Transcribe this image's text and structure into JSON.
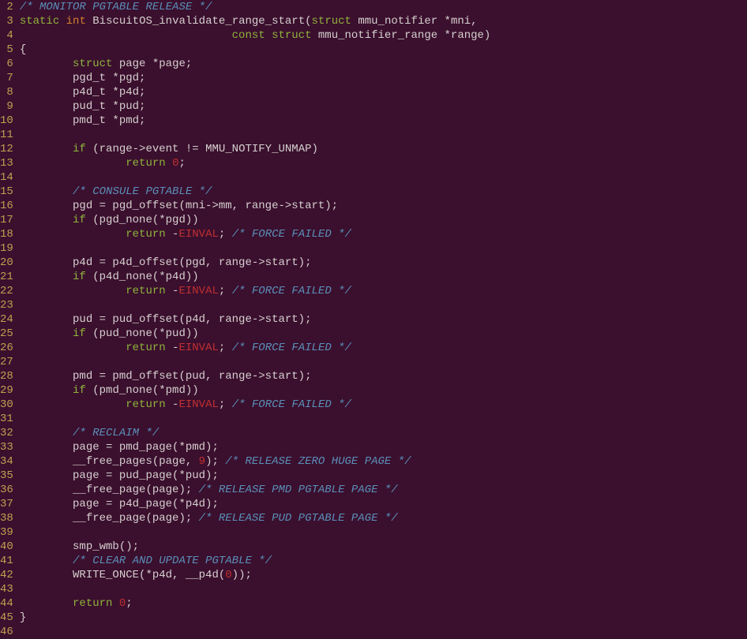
{
  "lines": [
    {
      "n": 2,
      "tokens": [
        {
          "cls": "c-comment",
          "t": "/* MONITOR PGTABLE RELEASE */"
        }
      ]
    },
    {
      "n": 3,
      "tokens": [
        {
          "cls": "c-keyword",
          "t": "static"
        },
        {
          "cls": "c-text",
          "t": " "
        },
        {
          "cls": "c-type",
          "t": "int"
        },
        {
          "cls": "c-text",
          "t": " BiscuitOS_invalidate_range_start("
        },
        {
          "cls": "c-keyword",
          "t": "struct"
        },
        {
          "cls": "c-text",
          "t": " mmu_notifier *mni,"
        }
      ]
    },
    {
      "n": 4,
      "tokens": [
        {
          "cls": "c-text",
          "t": "                                "
        },
        {
          "cls": "c-keyword",
          "t": "const"
        },
        {
          "cls": "c-text",
          "t": " "
        },
        {
          "cls": "c-keyword",
          "t": "struct"
        },
        {
          "cls": "c-text",
          "t": " mmu_notifier_range *range)"
        }
      ]
    },
    {
      "n": 5,
      "tokens": [
        {
          "cls": "c-text",
          "t": "{"
        }
      ]
    },
    {
      "n": 6,
      "tokens": [
        {
          "cls": "c-text",
          "t": "        "
        },
        {
          "cls": "c-keyword",
          "t": "struct"
        },
        {
          "cls": "c-text",
          "t": " page *page;"
        }
      ]
    },
    {
      "n": 7,
      "tokens": [
        {
          "cls": "c-text",
          "t": "        pgd_t *pgd;"
        }
      ]
    },
    {
      "n": 8,
      "tokens": [
        {
          "cls": "c-text",
          "t": "        p4d_t *p4d;"
        }
      ]
    },
    {
      "n": 9,
      "tokens": [
        {
          "cls": "c-text",
          "t": "        pud_t *pud;"
        }
      ]
    },
    {
      "n": 10,
      "tokens": [
        {
          "cls": "c-text",
          "t": "        pmd_t *pmd;"
        }
      ]
    },
    {
      "n": 11,
      "tokens": []
    },
    {
      "n": 12,
      "tokens": [
        {
          "cls": "c-text",
          "t": "        "
        },
        {
          "cls": "c-keyword",
          "t": "if"
        },
        {
          "cls": "c-text",
          "t": " (range->event != MMU_NOTIFY_UNMAP)"
        }
      ]
    },
    {
      "n": 13,
      "tokens": [
        {
          "cls": "c-text",
          "t": "                "
        },
        {
          "cls": "c-keyword",
          "t": "return"
        },
        {
          "cls": "c-text",
          "t": " "
        },
        {
          "cls": "c-num",
          "t": "0"
        },
        {
          "cls": "c-text",
          "t": ";"
        }
      ]
    },
    {
      "n": 14,
      "tokens": []
    },
    {
      "n": 15,
      "tokens": [
        {
          "cls": "c-text",
          "t": "        "
        },
        {
          "cls": "c-comment",
          "t": "/* CONSULE PGTABLE */"
        }
      ]
    },
    {
      "n": 16,
      "tokens": [
        {
          "cls": "c-text",
          "t": "        pgd = pgd_offset(mni->mm, range->start);"
        }
      ]
    },
    {
      "n": 17,
      "tokens": [
        {
          "cls": "c-text",
          "t": "        "
        },
        {
          "cls": "c-keyword",
          "t": "if"
        },
        {
          "cls": "c-text",
          "t": " (pgd_none(*pgd))"
        }
      ]
    },
    {
      "n": 18,
      "tokens": [
        {
          "cls": "c-text",
          "t": "                "
        },
        {
          "cls": "c-keyword",
          "t": "return"
        },
        {
          "cls": "c-text",
          "t": " -"
        },
        {
          "cls": "c-error",
          "t": "EINVAL"
        },
        {
          "cls": "c-text",
          "t": "; "
        },
        {
          "cls": "c-comment",
          "t": "/* FORCE FAILED */"
        }
      ]
    },
    {
      "n": 19,
      "tokens": []
    },
    {
      "n": 20,
      "tokens": [
        {
          "cls": "c-text",
          "t": "        p4d = p4d_offset(pgd, range->start);"
        }
      ]
    },
    {
      "n": 21,
      "tokens": [
        {
          "cls": "c-text",
          "t": "        "
        },
        {
          "cls": "c-keyword",
          "t": "if"
        },
        {
          "cls": "c-text",
          "t": " (p4d_none(*p4d))"
        }
      ]
    },
    {
      "n": 22,
      "tokens": [
        {
          "cls": "c-text",
          "t": "                "
        },
        {
          "cls": "c-keyword",
          "t": "return"
        },
        {
          "cls": "c-text",
          "t": " -"
        },
        {
          "cls": "c-error",
          "t": "EINVAL"
        },
        {
          "cls": "c-text",
          "t": "; "
        },
        {
          "cls": "c-comment",
          "t": "/* FORCE FAILED */"
        }
      ]
    },
    {
      "n": 23,
      "tokens": []
    },
    {
      "n": 24,
      "tokens": [
        {
          "cls": "c-text",
          "t": "        pud = pud_offset(p4d, range->start);"
        }
      ]
    },
    {
      "n": 25,
      "tokens": [
        {
          "cls": "c-text",
          "t": "        "
        },
        {
          "cls": "c-keyword",
          "t": "if"
        },
        {
          "cls": "c-text",
          "t": " (pud_none(*pud))"
        }
      ]
    },
    {
      "n": 26,
      "tokens": [
        {
          "cls": "c-text",
          "t": "                "
        },
        {
          "cls": "c-keyword",
          "t": "return"
        },
        {
          "cls": "c-text",
          "t": " -"
        },
        {
          "cls": "c-error",
          "t": "EINVAL"
        },
        {
          "cls": "c-text",
          "t": "; "
        },
        {
          "cls": "c-comment",
          "t": "/* FORCE FAILED */"
        }
      ]
    },
    {
      "n": 27,
      "tokens": []
    },
    {
      "n": 28,
      "tokens": [
        {
          "cls": "c-text",
          "t": "        pmd = pmd_offset(pud, range->start);"
        }
      ]
    },
    {
      "n": 29,
      "tokens": [
        {
          "cls": "c-text",
          "t": "        "
        },
        {
          "cls": "c-keyword",
          "t": "if"
        },
        {
          "cls": "c-text",
          "t": " (pmd_none(*pmd))"
        }
      ]
    },
    {
      "n": 30,
      "tokens": [
        {
          "cls": "c-text",
          "t": "                "
        },
        {
          "cls": "c-keyword",
          "t": "return"
        },
        {
          "cls": "c-text",
          "t": " -"
        },
        {
          "cls": "c-error",
          "t": "EINVAL"
        },
        {
          "cls": "c-text",
          "t": "; "
        },
        {
          "cls": "c-comment",
          "t": "/* FORCE FAILED */"
        }
      ]
    },
    {
      "n": 31,
      "tokens": []
    },
    {
      "n": 32,
      "tokens": [
        {
          "cls": "c-text",
          "t": "        "
        },
        {
          "cls": "c-comment",
          "t": "/* RECLAIM */"
        }
      ]
    },
    {
      "n": 33,
      "tokens": [
        {
          "cls": "c-text",
          "t": "        page = pmd_page(*pmd);"
        }
      ]
    },
    {
      "n": 34,
      "tokens": [
        {
          "cls": "c-text",
          "t": "        __free_pages(page, "
        },
        {
          "cls": "c-num",
          "t": "9"
        },
        {
          "cls": "c-text",
          "t": "); "
        },
        {
          "cls": "c-comment",
          "t": "/* RELEASE ZERO HUGE PAGE */"
        }
      ]
    },
    {
      "n": 35,
      "tokens": [
        {
          "cls": "c-text",
          "t": "        page = pud_page(*pud);"
        }
      ]
    },
    {
      "n": 36,
      "tokens": [
        {
          "cls": "c-text",
          "t": "        __free_page(page); "
        },
        {
          "cls": "c-comment",
          "t": "/* RELEASE PMD PGTABLE PAGE */"
        }
      ]
    },
    {
      "n": 37,
      "tokens": [
        {
          "cls": "c-text",
          "t": "        page = p4d_page(*p4d);"
        }
      ]
    },
    {
      "n": 38,
      "tokens": [
        {
          "cls": "c-text",
          "t": "        __free_page(page); "
        },
        {
          "cls": "c-comment",
          "t": "/* RELEASE PUD PGTABLE PAGE */"
        }
      ]
    },
    {
      "n": 39,
      "tokens": []
    },
    {
      "n": 40,
      "tokens": [
        {
          "cls": "c-text",
          "t": "        smp_wmb();"
        }
      ]
    },
    {
      "n": 41,
      "tokens": [
        {
          "cls": "c-text",
          "t": "        "
        },
        {
          "cls": "c-comment",
          "t": "/* CLEAR AND UPDATE PGTABLE */"
        }
      ]
    },
    {
      "n": 42,
      "tokens": [
        {
          "cls": "c-text",
          "t": "        WRITE_ONCE(*p4d, __p4d("
        },
        {
          "cls": "c-num",
          "t": "0"
        },
        {
          "cls": "c-text",
          "t": "));"
        }
      ]
    },
    {
      "n": 43,
      "tokens": []
    },
    {
      "n": 44,
      "tokens": [
        {
          "cls": "c-text",
          "t": "        "
        },
        {
          "cls": "c-keyword",
          "t": "return"
        },
        {
          "cls": "c-text",
          "t": " "
        },
        {
          "cls": "c-num",
          "t": "0"
        },
        {
          "cls": "c-text",
          "t": ";"
        }
      ]
    },
    {
      "n": 45,
      "tokens": [
        {
          "cls": "c-text",
          "t": "}"
        }
      ]
    },
    {
      "n": 46,
      "tokens": []
    }
  ]
}
